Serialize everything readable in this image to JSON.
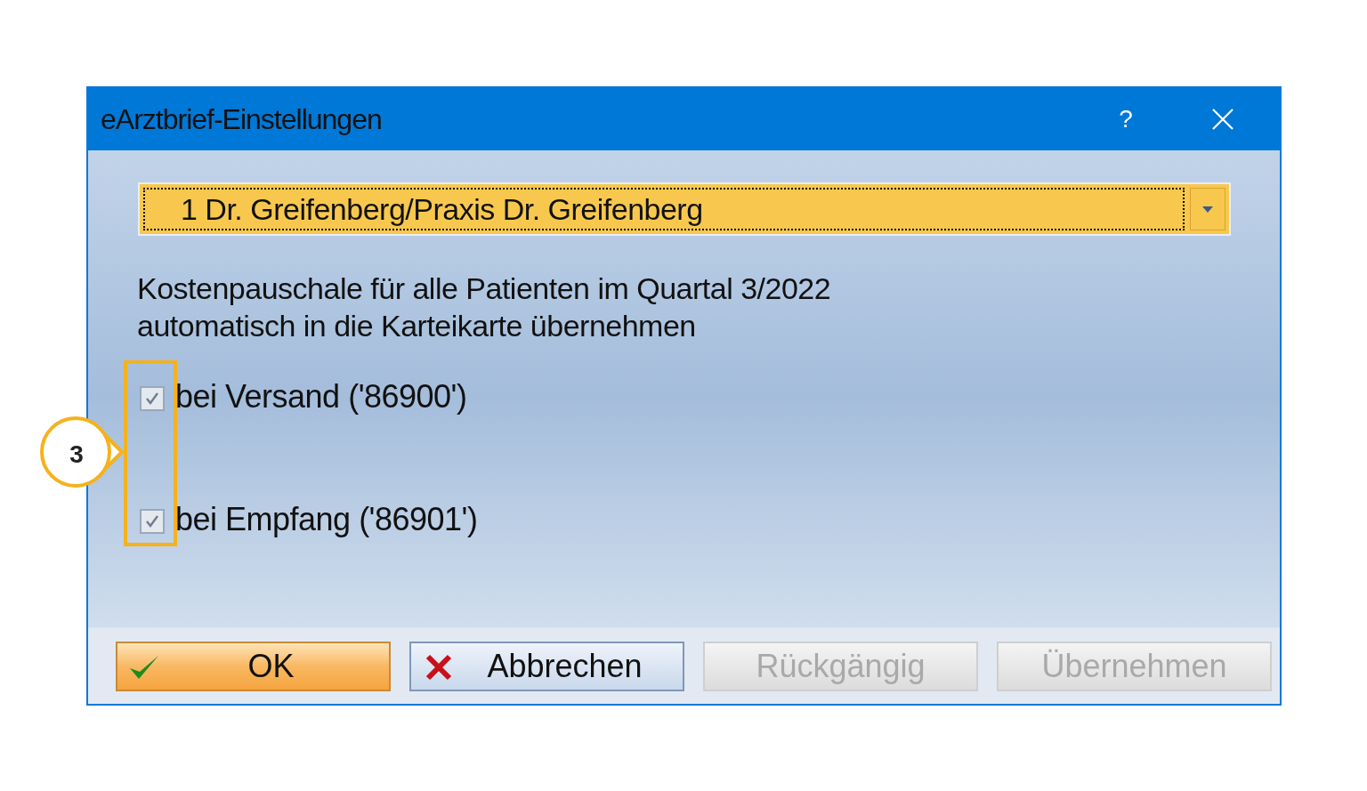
{
  "window": {
    "title": "eArztbrief-Einstellungen",
    "help": "?"
  },
  "dropdown": {
    "value": "1 Dr. Greifenberg/Praxis Dr. Greifenberg"
  },
  "description": "Kostenpauschale für alle Patienten im Quartal 3/2022\nautomatisch in die Karteikarte übernehmen",
  "checkboxes": [
    {
      "label": "bei Versand ('86900')",
      "checked": true
    },
    {
      "label": "bei Empfang ('86901')",
      "checked": true
    }
  ],
  "callout": {
    "label": "3"
  },
  "buttons": [
    {
      "label": "OK",
      "kind": "default",
      "disabled": false
    },
    {
      "label": "Abbrechen",
      "kind": "cancel",
      "disabled": false
    },
    {
      "label": "Rückgängig",
      "kind": "plain",
      "disabled": true
    },
    {
      "label": "Übernehmen",
      "kind": "plain",
      "disabled": true
    }
  ]
}
